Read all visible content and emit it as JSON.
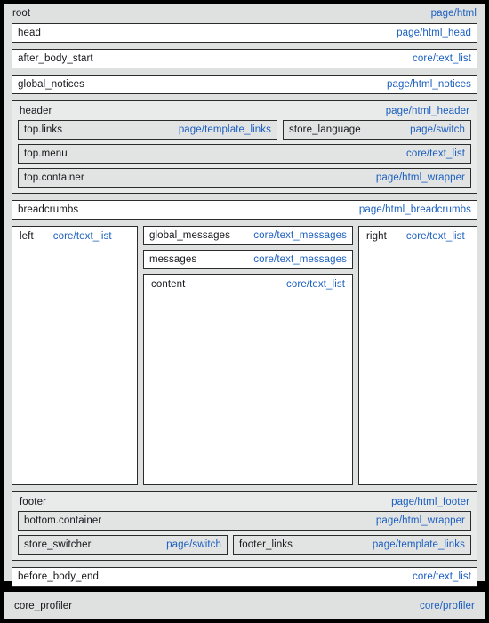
{
  "root": {
    "name": "root",
    "template": "page/html",
    "children": [
      {
        "name": "head",
        "template": "page/html_head"
      },
      {
        "name": "after_body_start",
        "template": "core/text_list"
      },
      {
        "name": "global_notices",
        "template": "page/html_notices"
      }
    ]
  },
  "header": {
    "name": "header",
    "template": "page/html_header",
    "top_links": {
      "name": "top.links",
      "template": "page/template_links"
    },
    "store_language": {
      "name": "store_language",
      "template": "page/switch"
    },
    "top_menu": {
      "name": "top.menu",
      "template": "core/text_list"
    },
    "top_container": {
      "name": "top.container",
      "template": "page/html_wrapper"
    }
  },
  "breadcrumbs": {
    "name": "breadcrumbs",
    "template": "page/html_breadcrumbs"
  },
  "columns": {
    "left": {
      "name": "left",
      "template": "core/text_list"
    },
    "center": {
      "global_messages": {
        "name": "global_messages",
        "template": "core/text_messages"
      },
      "messages": {
        "name": "messages",
        "template": "core/text_messages"
      },
      "content": {
        "name": "content",
        "template": "core/text_list"
      }
    },
    "right": {
      "name": "right",
      "template": "core/text_list"
    }
  },
  "footer": {
    "name": "footer",
    "template": "page/html_footer",
    "bottom_container": {
      "name": "bottom.container",
      "template": "page/html_wrapper"
    },
    "store_switcher": {
      "name": "store_switcher",
      "template": "page/switch"
    },
    "footer_links": {
      "name": "footer_links",
      "template": "page/template_links"
    }
  },
  "before_body_end": {
    "name": "before_body_end",
    "template": "core/text_list"
  },
  "profiler": {
    "name": "core_profiler",
    "template": "core/profiler"
  },
  "colors": {
    "panel_bg": "#dfe0e0",
    "leaf_bg": "#ffffff",
    "nested_bg": "#e2e3e3",
    "border": "#2b2b2b",
    "label": "#17171c",
    "link": "#1b5fc1",
    "outer": "#000000"
  }
}
